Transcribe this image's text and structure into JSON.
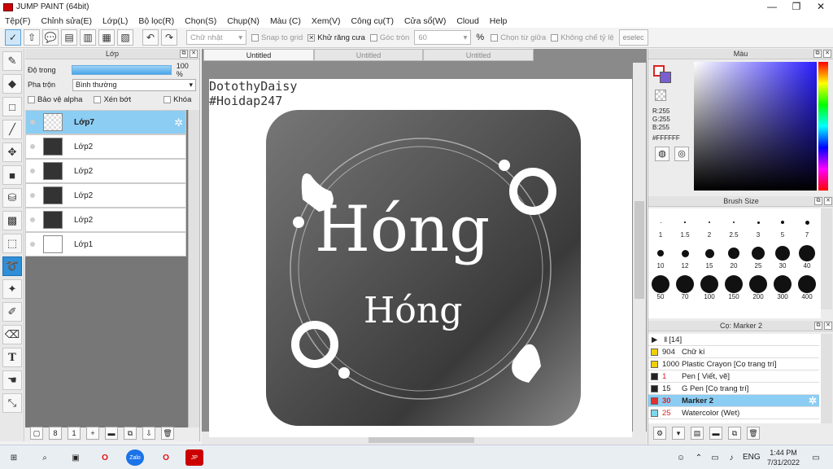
{
  "app": {
    "title": "JUMP PAINT (64bit)"
  },
  "menu": [
    "Tệp(F)",
    "Chỉnh sửa(E)",
    "Lớp(L)",
    "Bộ lọc(R)",
    "Chọn(S)",
    "Chụp(N)",
    "Màu (C)",
    "Xem(V)",
    "Công cụ(T)",
    "Cửa sổ(W)",
    "Cloud",
    "Help"
  ],
  "toolbar": {
    "shape_select": "Chữ nhật",
    "snap_grid": "Snap to grid",
    "antialias": "Khử răng cưa",
    "corner": "Góc tròn",
    "corner_value": "60",
    "percent": "%",
    "select_center": "Chọn từ giữa",
    "lock_ratio": "Không chế tỷ lệ",
    "deselect": "eselec"
  },
  "layers": {
    "title": "Lớp",
    "opacity_label": "Độ trong",
    "opacity_value": "100 %",
    "opacity_fill": 1.0,
    "blend_label": "Pha trộn",
    "blend_value": "Bình thường",
    "protect_alpha": "Bảo vệ alpha",
    "clipping": "Xén bớt",
    "lock": "Khóa",
    "items": [
      {
        "name": "Lớp7",
        "selected": true
      },
      {
        "name": "Lớp2",
        "selected": false
      },
      {
        "name": "Lớp2",
        "selected": false
      },
      {
        "name": "Lớp2",
        "selected": false
      },
      {
        "name": "Lớp2",
        "selected": false
      },
      {
        "name": "Lớp1",
        "selected": false
      }
    ]
  },
  "canvas": {
    "tabs": [
      "Untitled",
      "Untitled",
      "Untitled"
    ],
    "watermark_line1": "DotothyDaisy",
    "watermark_line2": "#Hoidap247",
    "art_text_large": "Hóng",
    "art_text_small": "Hóng"
  },
  "color": {
    "title": "Màu",
    "r": "R:255",
    "g": "G:255",
    "b": "B:255",
    "hex": "#FFFFFF"
  },
  "brush_size": {
    "title": "Brush Size",
    "sizes": [
      "1",
      "1.5",
      "2",
      "2.5",
      "3",
      "5",
      "7",
      "10",
      "12",
      "15",
      "20",
      "25",
      "30",
      "40",
      "50",
      "70",
      "100",
      "150",
      "200",
      "300",
      "400"
    ]
  },
  "brush_list": {
    "title": "Cọ: Marker 2",
    "header": "[14]",
    "items": [
      {
        "num": "904",
        "name": "Chữ kí",
        "color": "#f0d000",
        "selected": false
      },
      {
        "num": "1000",
        "name": "Plastic Crayon [Cọ trang trí]",
        "color": "#f0d000",
        "selected": false
      },
      {
        "num": "1",
        "name": "Pen [ Viết, vẽ]",
        "color": "#222222",
        "selected": false
      },
      {
        "num": "15",
        "name": "G Pen [Cọ trang trí]",
        "color": "#222222",
        "selected": false
      },
      {
        "num": "30",
        "name": "Marker 2",
        "color": "#e03030",
        "selected": true
      },
      {
        "num": "25",
        "name": "Watercolor (Wet)",
        "color": "#7fd8f0",
        "selected": false
      }
    ]
  },
  "taskbar": {
    "lang": "ENG",
    "time": "1:44 PM",
    "date": "7/31/2022"
  }
}
